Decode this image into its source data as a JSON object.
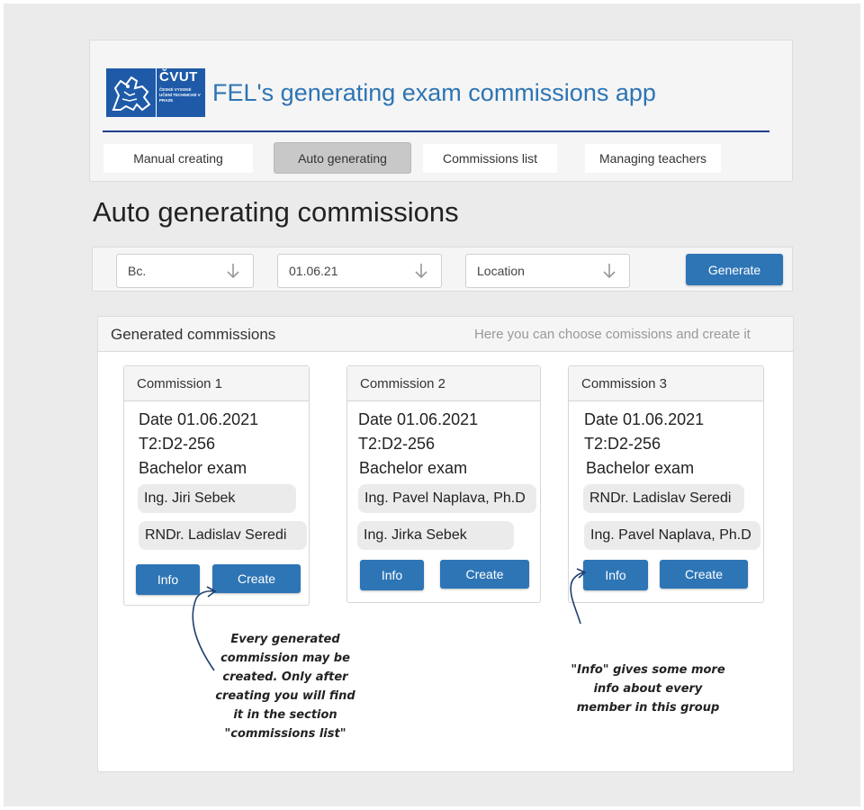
{
  "header": {
    "logo": {
      "title": "ČVUT",
      "subtitle": "ČESKÉ VYSOKÉ UČENÍ TECHNICKÉ V PRAZE"
    },
    "app_title": "FEL's generating exam commissions app",
    "accent": "#2d74b4",
    "tabs": [
      {
        "label": "Manual creating",
        "active": false
      },
      {
        "label": "Auto generating",
        "active": true
      },
      {
        "label": "Commissions list",
        "active": false
      },
      {
        "label": "Managing teachers",
        "active": false
      }
    ]
  },
  "page_title": "Auto generating commissions",
  "filters": {
    "degree": "Bc.",
    "date": "01.06.21",
    "location": "Location",
    "generate_label": "Generate"
  },
  "results": {
    "title": "Generated commissions",
    "hint": "Here you can choose comissions and create it",
    "commissions": [
      {
        "name": "Commission 1",
        "date": "Date 01.06.2021",
        "room": "T2:D2-256",
        "exam": "Bachelor exam",
        "members": [
          "Ing. Jiri Sebek",
          "RNDr. Ladislav Seredi"
        ],
        "info_label": "Info",
        "create_label": "Create"
      },
      {
        "name": "Commission 2",
        "date": "Date 01.06.2021",
        "room": "T2:D2-256",
        "exam": "Bachelor exam",
        "members": [
          "Ing. Pavel Naplava, Ph.D",
          "Ing. Jirka Sebek"
        ],
        "info_label": "Info",
        "create_label": "Create"
      },
      {
        "name": "Commission 3",
        "date": "Date 01.06.2021",
        "room": "T2:D2-256",
        "exam": "Bachelor exam",
        "members": [
          "RNDr. Ladislav Seredi",
          "Ing. Pavel Naplava, Ph.D"
        ],
        "info_label": "Info",
        "create_label": "Create"
      }
    ]
  },
  "annotations": {
    "create_note": [
      "Every generated",
      "commission may be",
      "created. Only after",
      "creating you will find",
      "it in the section",
      "\"commissions list\""
    ],
    "info_note": [
      "\"Info\" gives some more",
      "info about every",
      "member in this group"
    ]
  },
  "colors": {
    "primary_button": "#2e75b6",
    "header_line": "#1f3f8c",
    "active_tab": "#c8c8c8"
  }
}
